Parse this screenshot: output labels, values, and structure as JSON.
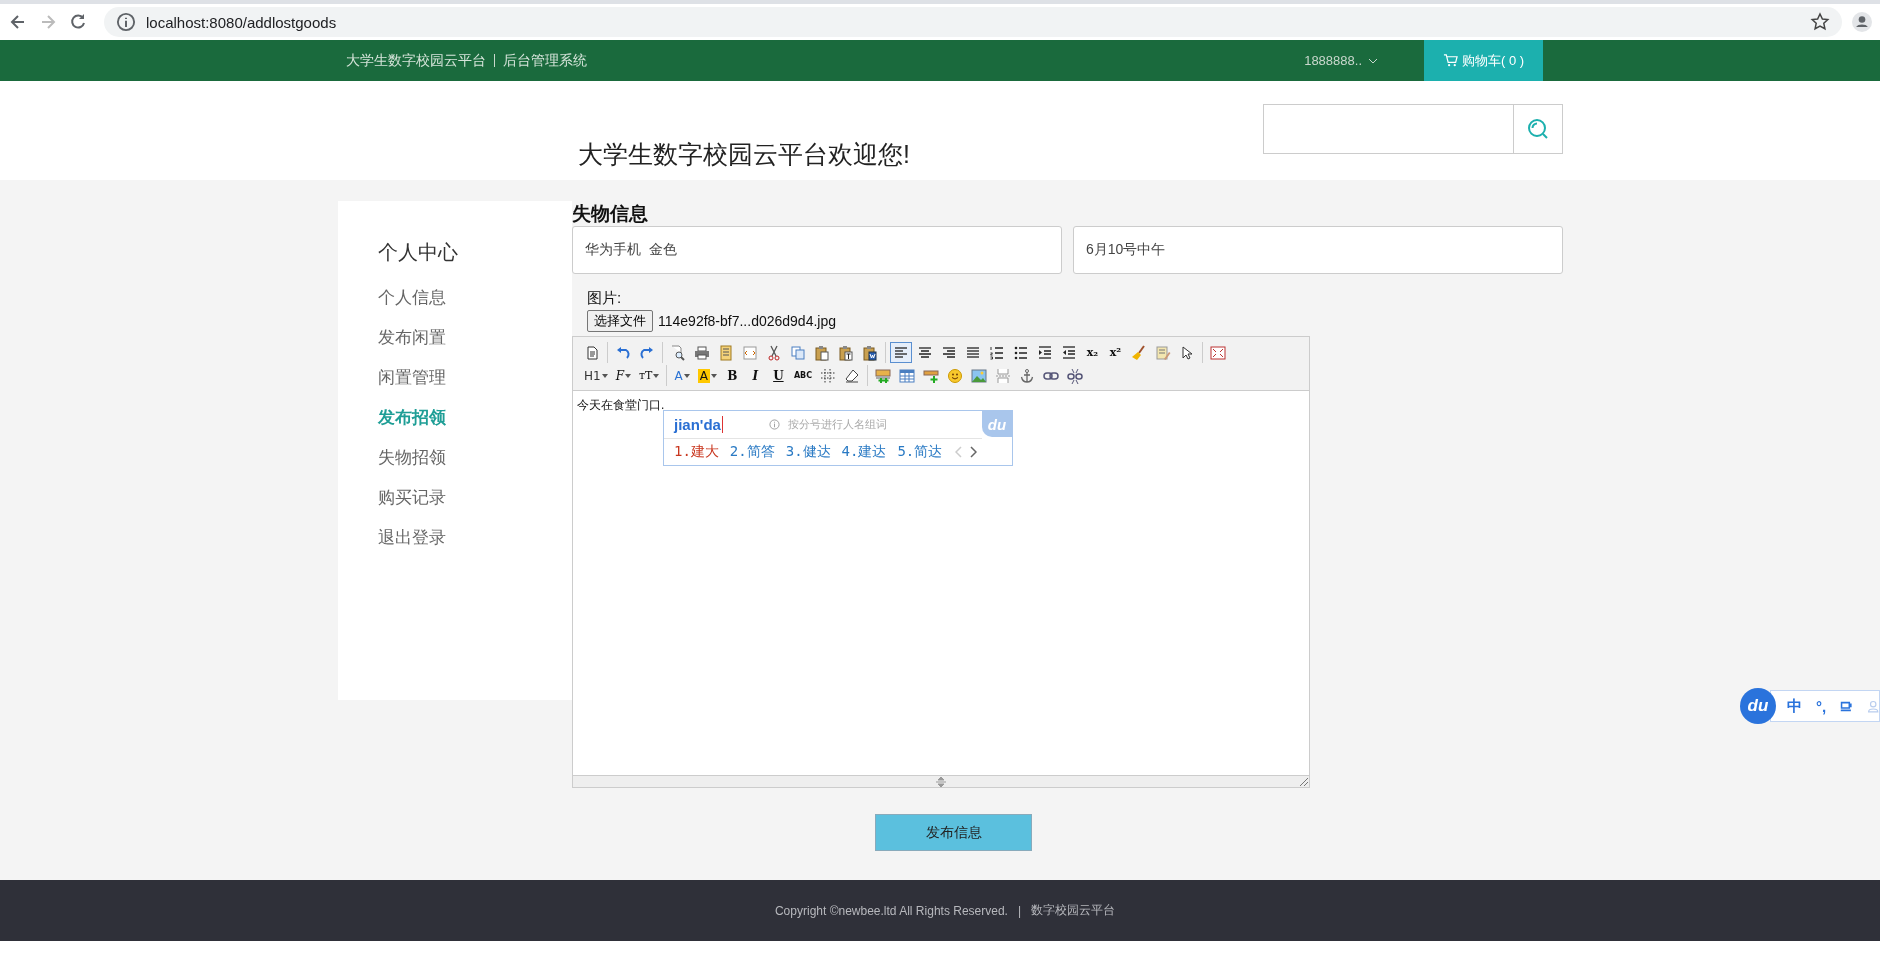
{
  "browser": {
    "url": "localhost:8080/addlostgoods"
  },
  "navbar": {
    "site_title": "大学生数字校园云平台",
    "subtitle": "后台管理系统",
    "user": "1888888..",
    "cart": "购物车( 0 )"
  },
  "header": {
    "welcome": "大学生数字校园云平台欢迎您!"
  },
  "sidebar": {
    "title": "个人中心",
    "items": [
      {
        "label": "个人信息",
        "selected": false
      },
      {
        "label": "发布闲置",
        "selected": false
      },
      {
        "label": "闲置管理",
        "selected": false
      },
      {
        "label": "发布招领",
        "selected": true
      },
      {
        "label": "失物招领",
        "selected": false
      },
      {
        "label": "购买记录",
        "selected": false
      },
      {
        "label": "退出登录",
        "selected": false
      }
    ]
  },
  "form": {
    "heading": "失物信息",
    "fields": [
      {
        "value": "华为手机  金色"
      },
      {
        "value": "6月10号中午"
      }
    ],
    "image_label": "图片:",
    "file_button": "选择文件",
    "file_name": "114e92f8-bf7...d026d9d4.jpg",
    "editor": {
      "toolbar": [
        [
          [
            {
              "kind": "source",
              "pressed": false
            }
          ],
          [
            {
              "kind": "undo",
              "pressed": false
            },
            {
              "kind": "redo",
              "pressed": false
            }
          ],
          [
            {
              "kind": "preview",
              "pressed": false
            },
            {
              "kind": "print",
              "pressed": false
            },
            {
              "kind": "template",
              "pressed": false
            },
            {
              "kind": "code",
              "pressed": false
            },
            {
              "kind": "cut",
              "pressed": false
            },
            {
              "kind": "copy",
              "pressed": false
            },
            {
              "kind": "paste",
              "pressed": false
            },
            {
              "kind": "paste-text",
              "pressed": false
            },
            {
              "kind": "paste-word",
              "pressed": false
            }
          ],
          [
            {
              "kind": "align-left",
              "pressed": true
            },
            {
              "kind": "align-center",
              "pressed": false
            },
            {
              "kind": "align-right",
              "pressed": false
            },
            {
              "kind": "justify",
              "pressed": false
            },
            {
              "kind": "ordered-list",
              "pressed": false
            },
            {
              "kind": "unordered-list",
              "pressed": false
            },
            {
              "kind": "indent",
              "pressed": false
            },
            {
              "kind": "outdent",
              "pressed": false
            },
            {
              "kind": "subscript",
              "label": "x₂",
              "pressed": false
            },
            {
              "kind": "superscript",
              "label": "x²",
              "pressed": false
            },
            {
              "kind": "clear-format",
              "pressed": false
            },
            {
              "kind": "select-all",
              "pressed": false
            },
            {
              "kind": "pointer",
              "pressed": false
            }
          ],
          [
            {
              "kind": "fullscreen",
              "pressed": false
            }
          ]
        ],
        [
          [
            {
              "kind": "heading",
              "label": "H1",
              "pressed": false
            },
            {
              "kind": "font-family",
              "label": "F",
              "pressed": false
            },
            {
              "kind": "font-size",
              "label": "ᴛT",
              "pressed": false
            }
          ],
          [
            {
              "kind": "font-color",
              "label": "A",
              "pressed": false
            },
            {
              "kind": "highlight",
              "label": "A",
              "pressed": false
            },
            {
              "kind": "bold",
              "label": "B",
              "pressed": false
            },
            {
              "kind": "italic",
              "label": "I",
              "pressed": false
            },
            {
              "kind": "underline",
              "label": "U",
              "pressed": false
            },
            {
              "kind": "strike",
              "label": "ABC",
              "pressed": false
            },
            {
              "kind": "dotted-grid",
              "pressed": false
            },
            {
              "kind": "eraser",
              "pressed": false
            }
          ],
          [
            {
              "kind": "row-insert",
              "pressed": false
            },
            {
              "kind": "table",
              "pressed": false
            },
            {
              "kind": "insert-row",
              "pressed": false
            },
            {
              "kind": "emoji",
              "pressed": false
            },
            {
              "kind": "picture",
              "pressed": false
            },
            {
              "kind": "page-break",
              "pressed": false
            },
            {
              "kind": "anchor",
              "pressed": false
            },
            {
              "kind": "link",
              "pressed": false
            },
            {
              "kind": "unlink",
              "pressed": false
            }
          ]
        ]
      ],
      "content": "今天在食堂门口."
    },
    "submit": "发布信息"
  },
  "ime_popup": {
    "composition": "jian'da",
    "hint": "按分号进行人名组词",
    "logo": "du",
    "candidates": [
      {
        "label": "1.建大",
        "selected": true
      },
      {
        "label": "2.简答",
        "selected": false
      },
      {
        "label": "3.健达",
        "selected": false
      },
      {
        "label": "4.建达",
        "selected": false
      },
      {
        "label": "5.简达",
        "selected": false
      }
    ]
  },
  "ime_bar": {
    "logo": "du",
    "mode": "中",
    "punctuation": "°,"
  },
  "footer": {
    "copyright": "Copyright ©newbee.ltd All Rights Reserved.",
    "separator": "|",
    "site": "数字校园云平台"
  }
}
